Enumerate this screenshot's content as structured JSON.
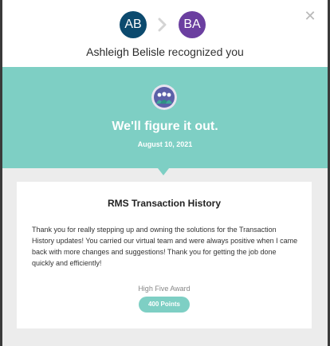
{
  "colors": {
    "teal": "#7ecfc4",
    "avatar_from": "#0c4a6e",
    "avatar_to": "#6b3fa0",
    "points_badge": "#7ecfc4"
  },
  "header": {
    "from_initials": "AB",
    "to_initials": "BA",
    "separator_icon": "chevron-right-icon",
    "close_icon": "close-icon"
  },
  "recognition": {
    "name": "Ashleigh Belisle",
    "verb_text": "recognized you"
  },
  "banner": {
    "icon": "team-icon",
    "headline": "We'll figure it out.",
    "date": "August 10, 2021"
  },
  "card": {
    "title": "RMS Transaction History",
    "message": "Thank you for really stepping up and owning the solutions for the Transaction History updates! You carried our virtual team and were always positive when I came back with more changes and suggestions! Thank you for getting the job done quickly and efficiently!",
    "award_type": "High Five Award",
    "points": "400 Points"
  }
}
